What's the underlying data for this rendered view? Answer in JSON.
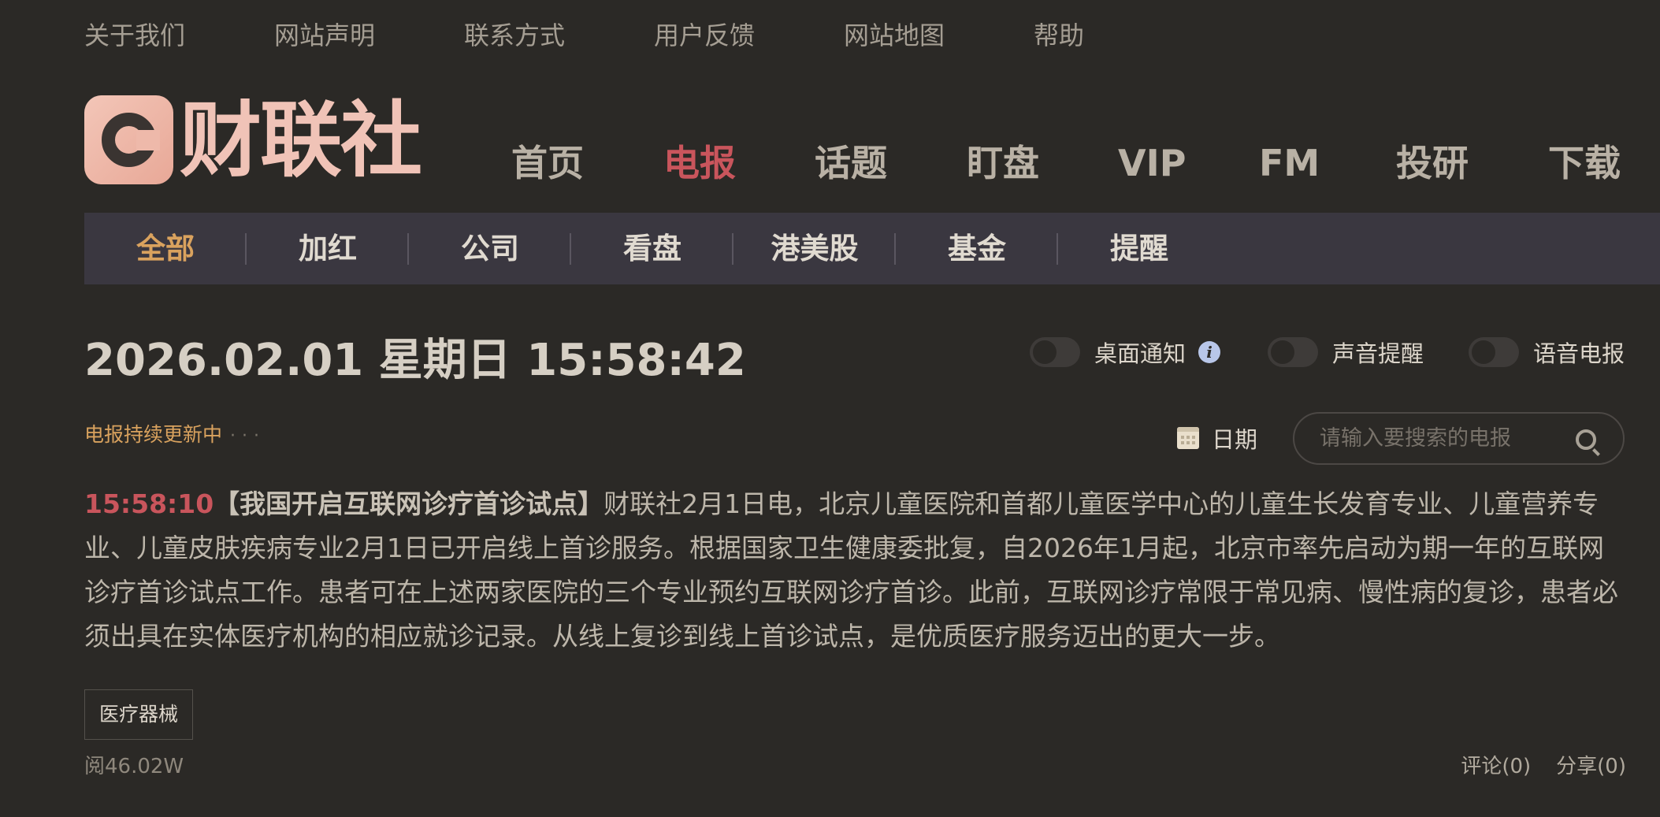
{
  "top_links": [
    "关于我们",
    "网站声明",
    "联系方式",
    "用户反馈",
    "网站地图",
    "帮助"
  ],
  "logo": {
    "text": "财联社"
  },
  "main_nav": [
    "首页",
    "电报",
    "话题",
    "盯盘",
    "VIP",
    "FM",
    "投研",
    "下载"
  ],
  "main_nav_active": "电报",
  "sub_nav": [
    "全部",
    "加红",
    "公司",
    "看盘",
    "港美股",
    "基金",
    "提醒"
  ],
  "sub_nav_active": "全部",
  "datetime": "2026.02.01 星期日 15:58:42",
  "toggles": {
    "desktop_notify": {
      "label": "桌面通知",
      "on": false
    },
    "sound_alert": {
      "label": "声音提醒",
      "on": false
    },
    "voice_telegraph": {
      "label": "语音电报",
      "on": false
    }
  },
  "status": {
    "updating": "电报持续更新中"
  },
  "date_filter": {
    "label": "日期"
  },
  "search": {
    "placeholder": "请输入要搜索的电报",
    "value": ""
  },
  "article": {
    "time": "15:58:10",
    "headline": "【我国开启互联网诊疗首诊试点】",
    "body": "财联社2月1日电，北京儿童医院和首都儿童医学中心的儿童生长发育专业、儿童营养专业、儿童皮肤疾病专业2月1日已开启线上首诊服务。根据国家卫生健康委批复，自2026年1月起，北京市率先启动为期一年的互联网诊疗首诊试点工作。患者可在上述两家医院的三个专业预约互联网诊疗首诊。此前，互联网诊疗常限于常见病、慢性病的复诊，患者必须出具在实体医疗机构的相应就诊记录。从线上复诊到线上首诊试点，是优质医疗服务迈出的更大一步。",
    "tag": "医疗器械",
    "reads": "阅46.02W",
    "comment": "评论(0)",
    "share": "分享(0)"
  },
  "colors": {
    "background": "#2b2926",
    "accent_red": "#c9555c",
    "accent_gold": "#d9a25e",
    "subnav_bg": "#3a3740"
  }
}
